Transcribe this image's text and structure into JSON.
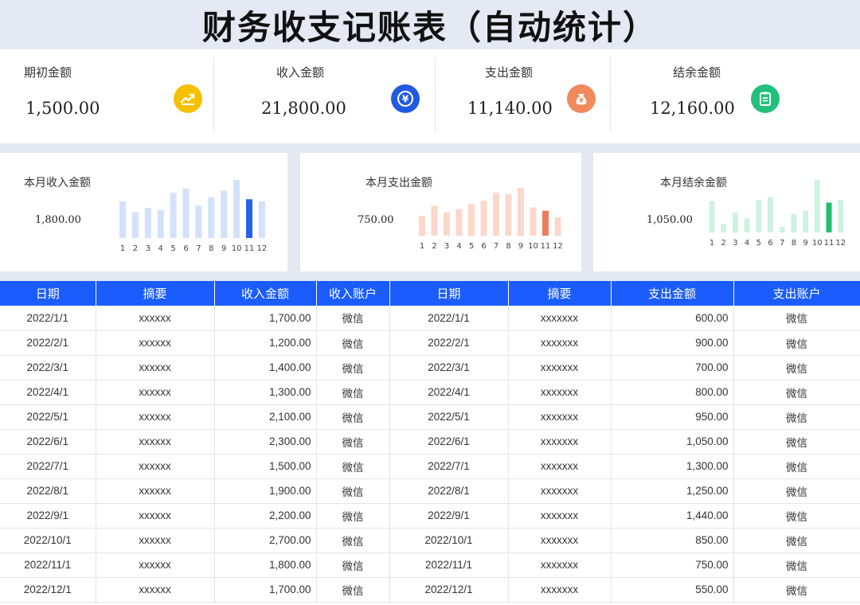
{
  "title": "财务收支记账表（自动统计）",
  "summary": [
    {
      "label": "期初金额",
      "value": "1,500.00",
      "icon": "trend-up-icon",
      "color": "#f5c000"
    },
    {
      "label": "收入金额",
      "value": "21,800.00",
      "icon": "yen-refresh-icon",
      "color": "#1f5ae0"
    },
    {
      "label": "支出金额",
      "value": "11,140.00",
      "icon": "money-bag-icon",
      "color": "#f08a5d"
    },
    {
      "label": "结余金额",
      "value": "12,160.00",
      "icon": "clipboard-icon",
      "color": "#22c07a"
    }
  ],
  "panels": [
    {
      "title": "本月收入金额",
      "value": "1,800.00"
    },
    {
      "title": "本月支出金额",
      "value": "750.00"
    },
    {
      "title": "本月结余金额",
      "value": "1,050.00"
    }
  ],
  "chart_data": [
    {
      "type": "bar",
      "categories": [
        "1",
        "2",
        "3",
        "4",
        "5",
        "6",
        "7",
        "8",
        "9",
        "10",
        "11",
        "12"
      ],
      "values": [
        1700,
        1200,
        1400,
        1300,
        2100,
        2300,
        1500,
        1900,
        2200,
        2700,
        1800,
        1700
      ],
      "highlight_index": 10,
      "colors": {
        "normal": "#d3e1fb",
        "highlight": "#2463e8"
      }
    },
    {
      "type": "bar",
      "categories": [
        "1",
        "2",
        "3",
        "4",
        "5",
        "6",
        "7",
        "8",
        "9",
        "10",
        "11",
        "12"
      ],
      "values": [
        600,
        900,
        700,
        800,
        950,
        1050,
        1300,
        1250,
        1440,
        850,
        750,
        550
      ],
      "highlight_index": 10,
      "colors": {
        "normal": "#fbd7cc",
        "highlight": "#ef7b5c"
      }
    },
    {
      "type": "bar",
      "categories": [
        "1",
        "2",
        "3",
        "4",
        "5",
        "6",
        "7",
        "8",
        "9",
        "10",
        "11",
        "12"
      ],
      "values": [
        1100,
        300,
        700,
        500,
        1150,
        1250,
        200,
        650,
        760,
        1850,
        1050,
        1150
      ],
      "highlight_index": 10,
      "colors": {
        "normal": "#cdf3e0",
        "highlight": "#1fbf6e"
      }
    }
  ],
  "table": {
    "headers": [
      "日期",
      "摘要",
      "收入金额",
      "收入账户",
      "日期",
      "摘要",
      "支出金额",
      "支出账户"
    ],
    "rows": [
      [
        "2022/1/1",
        "xxxxxx",
        "1,700.00",
        "微信",
        "2022/1/1",
        "xxxxxxx",
        "600.00",
        "微信"
      ],
      [
        "2022/2/1",
        "xxxxxx",
        "1,200.00",
        "微信",
        "2022/2/1",
        "xxxxxxx",
        "900.00",
        "微信"
      ],
      [
        "2022/3/1",
        "xxxxxx",
        "1,400.00",
        "微信",
        "2022/3/1",
        "xxxxxxx",
        "700.00",
        "微信"
      ],
      [
        "2022/4/1",
        "xxxxxx",
        "1,300.00",
        "微信",
        "2022/4/1",
        "xxxxxxx",
        "800.00",
        "微信"
      ],
      [
        "2022/5/1",
        "xxxxxx",
        "2,100.00",
        "微信",
        "2022/5/1",
        "xxxxxxx",
        "950.00",
        "微信"
      ],
      [
        "2022/6/1",
        "xxxxxx",
        "2,300.00",
        "微信",
        "2022/6/1",
        "xxxxxxx",
        "1,050.00",
        "微信"
      ],
      [
        "2022/7/1",
        "xxxxxx",
        "1,500.00",
        "微信",
        "2022/7/1",
        "xxxxxxx",
        "1,300.00",
        "微信"
      ],
      [
        "2022/8/1",
        "xxxxxx",
        "1,900.00",
        "微信",
        "2022/8/1",
        "xxxxxxx",
        "1,250.00",
        "微信"
      ],
      [
        "2022/9/1",
        "xxxxxx",
        "2,200.00",
        "微信",
        "2022/9/1",
        "xxxxxxx",
        "1,440.00",
        "微信"
      ],
      [
        "2022/10/1",
        "xxxxxx",
        "2,700.00",
        "微信",
        "2022/10/1",
        "xxxxxxx",
        "850.00",
        "微信"
      ],
      [
        "2022/11/1",
        "xxxxxx",
        "1,800.00",
        "微信",
        "2022/11/1",
        "xxxxxxx",
        "750.00",
        "微信"
      ],
      [
        "2022/12/1",
        "xxxxxx",
        "1,700.00",
        "微信",
        "2022/12/1",
        "xxxxxxx",
        "550.00",
        "微信"
      ]
    ]
  }
}
